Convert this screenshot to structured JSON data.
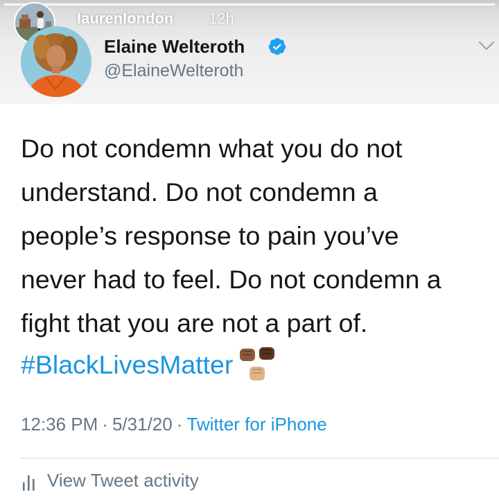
{
  "story": {
    "username": "laurenlondon",
    "time": "12h",
    "avatar_icon": "profile-photo",
    "avatar_alt": "laurenlondon"
  },
  "tweet": {
    "author_name": "Elaine Welteroth",
    "author_handle": "@ElaineWelteroth",
    "verified_icon": "verified-badge-icon",
    "text": "Do not condemn what you do not\nunderstand. Do not condemn a\npeople’s response to pain you’ve\nnever had to feel. Do not condemn a\nfight that you are not a part of.",
    "hashtag": "#BlackLivesMatter",
    "emoji_icon": "raised-fists-icon",
    "time": "12:36 PM",
    "separator": "·",
    "date": "5/31/20",
    "source": "Twitter for iPhone",
    "activity_label": "View Tweet activity",
    "activity_icon": "bar-chart-icon"
  },
  "colors": {
    "link_blue": "#1b95e0",
    "verified_blue": "#1da1f2",
    "text_primary": "#14171a",
    "text_secondary": "#657786",
    "divider": "#e6ecf0"
  }
}
